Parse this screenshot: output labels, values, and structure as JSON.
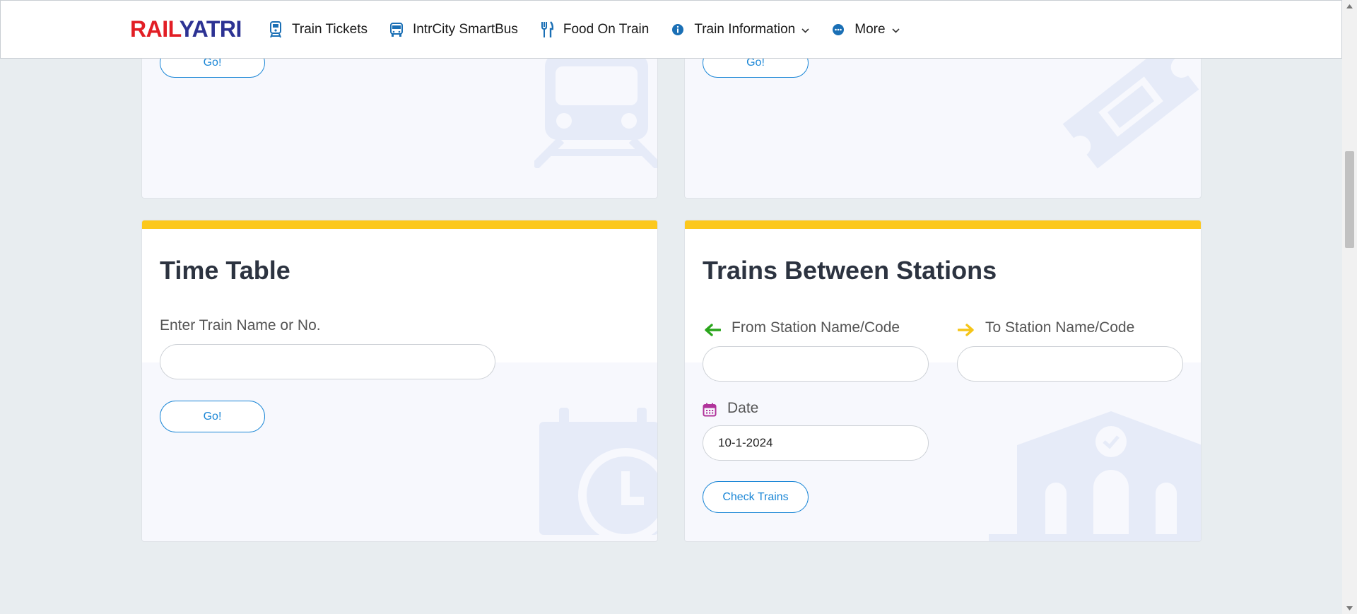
{
  "header": {
    "logo_part1": "RAIL",
    "logo_part2": "YATRI",
    "nav": [
      {
        "label": "Train Tickets",
        "icon": "train-icon"
      },
      {
        "label": "IntrCity SmartBus",
        "icon": "bus-icon"
      },
      {
        "label": "Food On Train",
        "icon": "fork-knife-icon"
      },
      {
        "label": "Train Information",
        "icon": "info-icon"
      },
      {
        "label": "More",
        "icon": "more-dots-icon"
      }
    ]
  },
  "cards": {
    "top_left": {
      "go_label": "Go!"
    },
    "top_right": {
      "go_label": "Go!"
    },
    "time_table": {
      "title": "Time Table",
      "input_label": "Enter Train Name or No.",
      "input_value": "",
      "go_label": "Go!"
    },
    "trains_between": {
      "title": "Trains Between Stations",
      "from_label": "From Station Name/Code",
      "to_label": "To Station Name/Code",
      "date_label": "Date",
      "date_value": "10-1-2024",
      "button_label": "Check Trains"
    }
  },
  "colors": {
    "accent_blue": "#1a86d6",
    "card_top_bar": "#fcc81d",
    "logo_red": "#e21e25",
    "logo_blue": "#2c3293",
    "from_arrow": "#2aa51c",
    "to_arrow": "#f5c518",
    "date_icon": "#b0339a",
    "bg_art": "#e6ebf8"
  }
}
